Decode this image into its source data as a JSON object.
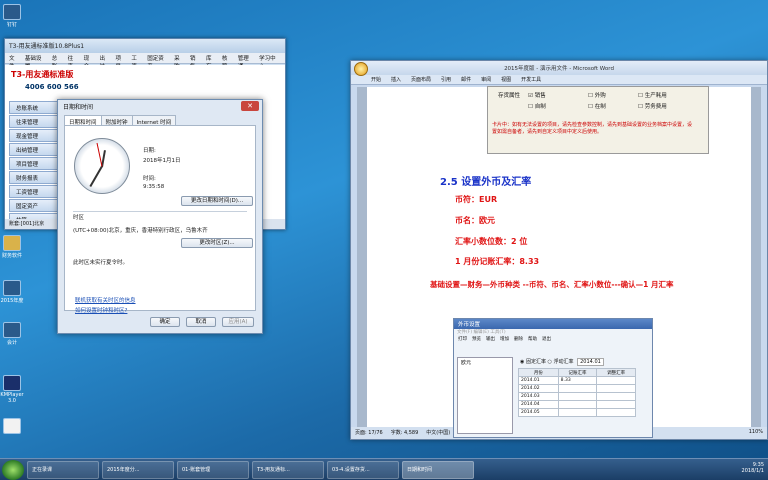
{
  "desktop": {
    "icons": [
      "钉钉",
      "财务软件",
      "2015年度",
      "会计",
      "QQ",
      "计算机",
      "KMPlayer 3.0"
    ]
  },
  "t3": {
    "title": "T3-用友通标准版10.8Plus1",
    "menu": [
      "文件",
      "基础设置",
      "总账",
      "往来",
      "现金",
      "出纳",
      "项目",
      "工资",
      "固定资产",
      "采购",
      "销售",
      "库存",
      "核算",
      "管理通",
      "学习中心"
    ],
    "logo": "T3-用友通标准版",
    "phone": "4006 600 566",
    "nav": [
      "总账系统",
      "往来管理",
      "现金管理",
      "出纳管理",
      "项目管理",
      "财务报表",
      "工资管理",
      "固定资产",
      "核算"
    ],
    "status": "账套:[001]北京"
  },
  "dialog": {
    "title": "日期和时间",
    "tabs": [
      "日期和时间",
      "附加时钟",
      "Internet 时间"
    ],
    "date_label": "日期:",
    "date_value": "2018年1月1日",
    "time_label": "时间:",
    "time_value": "9:35:58",
    "change_dt_button": "更改日期和时间(D)...",
    "timezone_label": "时区",
    "timezone_value": "(UTC+08:00)北京，重庆，香港特别行政区，乌鲁木齐",
    "change_tz_button": "更改时区(Z)...",
    "dst_text": "此时区未实行夏令时。",
    "link1": "联机获取有关时区的信息",
    "link2": "如何设置时钟和时区?",
    "ok": "确定",
    "cancel": "取消",
    "apply": "应用(A)"
  },
  "word": {
    "title": "2015年度版 - 演示用文件 - Microsoft Word",
    "tabs": [
      "开始",
      "插入",
      "页面布局",
      "引用",
      "邮件",
      "审阅",
      "视图",
      "开发工具"
    ],
    "snip_row1": "存货属性",
    "snip_opts": [
      "销售",
      "外购",
      "生产耗用",
      "自制",
      "在制",
      "劳务费用"
    ],
    "snip_hint": "卡片中：如有无法设置的项目，请先检查参数控制，请先到基础设置的业务档案中设置，设置如需自备者，请先到自定义项目中定义后使用。",
    "heading": "2.5 设置外币及汇率",
    "lines": [
      "币符：EUR",
      "币名：欧元",
      "汇率小数位数：2 位",
      "1 月份记账汇率：8.33"
    ],
    "instruction": "基础设置—财务—外币种类 --币符、币名、汇率小数位---确认—1 月汇率",
    "status_page": "页面: 17/76",
    "status_words": "字数: 4,589",
    "status_lang": "中文(中国)",
    "status_mode": "插入",
    "zoom": "110%"
  },
  "currency": {
    "title": "外币设置",
    "menu": "文件(F)  编辑(E)  工具(T)",
    "toolbar": [
      "打印",
      "预览",
      "输出",
      "增加",
      "删除",
      "帮助",
      "退出"
    ],
    "list_item": "欧元",
    "radio_fixed": "固定汇率",
    "radio_float": "浮动汇率",
    "period": "2014.01",
    "headers": [
      "月份",
      "记账汇率",
      "调整汇率"
    ],
    "rows": [
      [
        "2014.01",
        "8.33",
        ""
      ],
      [
        "2014.02",
        "",
        ""
      ],
      [
        "2014.03",
        "",
        ""
      ],
      [
        "2014.04",
        "",
        ""
      ],
      [
        "2014.05",
        "",
        ""
      ]
    ]
  },
  "taskbar": {
    "items": [
      "正在录课",
      "2015年度分...",
      "01-账套管理",
      "T3-用友通标...",
      "03-4.设置存货...",
      "日期和时间"
    ],
    "time": "9:35",
    "date": "2018/1/1"
  }
}
